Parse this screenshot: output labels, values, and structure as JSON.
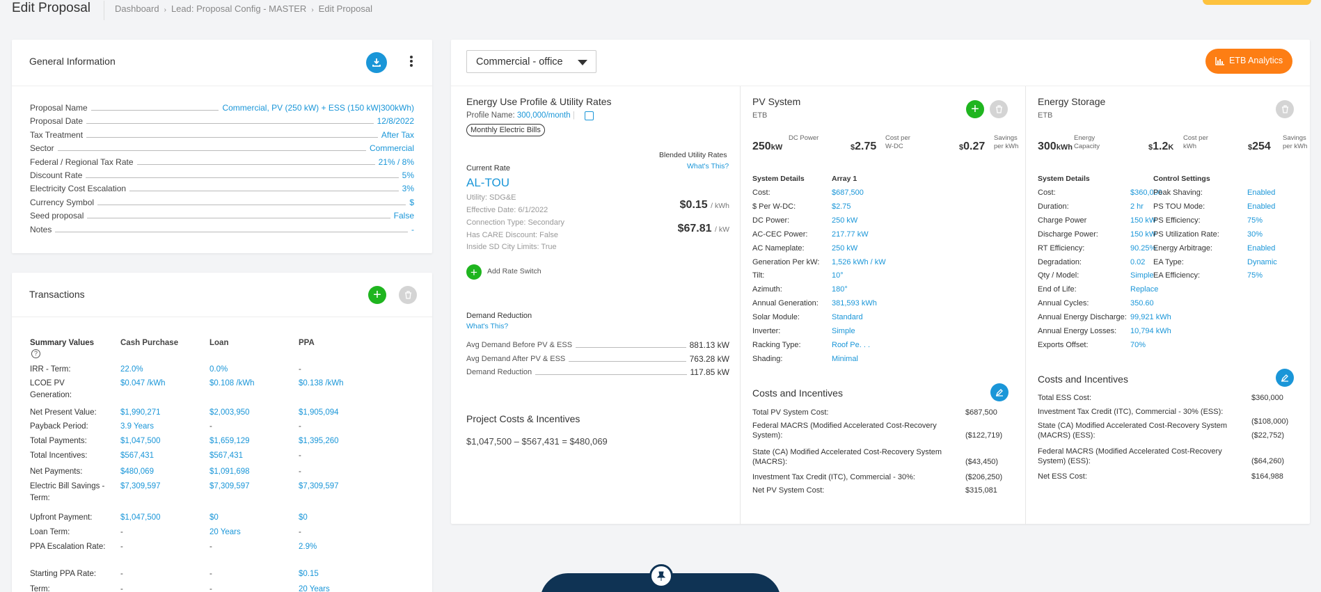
{
  "header": {
    "title": "Edit Proposal",
    "breadcrumbs": [
      "Dashboard",
      "Lead: Proposal Config - MASTER",
      "Edit Proposal"
    ]
  },
  "general": {
    "title": "General Information",
    "fields": [
      {
        "label": "Proposal Name",
        "value": "Commercial, PV (250 kW) + ESS (150 kW|300kWh)"
      },
      {
        "label": "Proposal Date",
        "value": "12/8/2022"
      },
      {
        "label": "Tax Treatment",
        "value": "After Tax"
      },
      {
        "label": "Sector",
        "value": "Commercial"
      },
      {
        "label": "Federal / Regional Tax Rate",
        "value": "21% / 8%"
      },
      {
        "label": "Discount Rate",
        "value": "5%"
      },
      {
        "label": "Electricity Cost Escalation",
        "value": "3%"
      },
      {
        "label": "Currency Symbol",
        "value": "$"
      },
      {
        "label": "Seed proposal",
        "value": "False"
      },
      {
        "label": "Notes",
        "value": "-"
      }
    ]
  },
  "transactions": {
    "title": "Transactions",
    "headers": [
      "Summary Values",
      "Cash Purchase",
      "Loan",
      "PPA"
    ],
    "help_icon": "question-circle-icon",
    "rows": [
      {
        "label": "IRR - Term:",
        "cash": "22.0%",
        "loan": "0.0%",
        "ppa": "-"
      },
      {
        "label": "LCOE PV Generation:",
        "cash": "$0.047 /kWh",
        "loan": "$0.108 /kWh",
        "ppa": "$0.138 /kWh"
      },
      {
        "label": "Net Present Value:",
        "cash": "$1,990,271",
        "loan": "$2,003,950",
        "ppa": "$1,905,094"
      },
      {
        "label": "Payback Period:",
        "cash": "3.9 Years",
        "loan": "-",
        "ppa": "-"
      },
      {
        "label": "Total Payments:",
        "cash": "$1,047,500",
        "loan": "$1,659,129",
        "ppa": "$1,395,260"
      },
      {
        "label": "Total Incentives:",
        "cash": "$567,431",
        "loan": "$567,431",
        "ppa": "-"
      },
      {
        "label": "Net Payments:",
        "cash": "$480,069",
        "loan": "$1,091,698",
        "ppa": "-"
      },
      {
        "label": "Electric Bill Savings - Term:",
        "cash": "$7,309,597",
        "loan": "$7,309,597",
        "ppa": "$7,309,597"
      },
      {
        "label": "Upfront Payment:",
        "cash": "$1,047,500",
        "loan": "$0",
        "ppa": "$0"
      },
      {
        "label": "Loan Term:",
        "cash": "-",
        "loan": "20 Years",
        "ppa": "-"
      },
      {
        "label": "PPA Escalation Rate:",
        "cash": "-",
        "loan": "-",
        "ppa": "2.9%"
      },
      {
        "label": "Starting PPA Rate:",
        "cash": "-",
        "loan": "-",
        "ppa": "$0.15"
      },
      {
        "label": "Term:",
        "cash": "-",
        "loan": "-",
        "ppa": "20 Years"
      }
    ]
  },
  "main": {
    "select_value": "Commercial - office",
    "analytics_label": "ETB Analytics"
  },
  "energy": {
    "title": "Energy Use Profile & Utility Rates",
    "profile_label": "Profile Name:",
    "profile_value": "300,000/month",
    "bills_badge": "Monthly Electric Bills",
    "blended_label": "Blended Utility Rates",
    "whats_this": "What's This?",
    "current_rate_label": "Current Rate",
    "rate_name": "AL-TOU",
    "utility": "Utility: SDG&E",
    "effective": "Effective Date: 6/1/2022",
    "connection": "Connection Type: Secondary",
    "care": "Has CARE Discount: False",
    "limits": "Inside SD City Limits: True",
    "kwh_rate": "$0.15",
    "kwh_unit": "/ kWh",
    "kw_rate": "$67.81",
    "kw_unit": "/ kW",
    "add_rate_switch": "Add Rate Switch",
    "demand_title": "Demand Reduction",
    "demand_whats": "What's This?",
    "demand_rows": [
      {
        "label": "Avg Demand Before PV & ESS",
        "value": "881.13 kW"
      },
      {
        "label": "Avg Demand After PV & ESS",
        "value": "763.28 kW"
      },
      {
        "label": "Demand Reduction",
        "value": "117.85 kW"
      }
    ],
    "project_title": "Project Costs & Incentives",
    "project_formula": "$1,047,500 – $567,431 = $480,069"
  },
  "pv": {
    "title": "PV System",
    "subtitle": "ETB",
    "stats": [
      {
        "value": "250",
        "unit": "kW",
        "label": "DC Power"
      },
      {
        "value": "2.75",
        "prefix": "$",
        "label": "Cost per W-DC"
      },
      {
        "value": "0.27",
        "prefix": "$",
        "label": "Savings per kWh"
      }
    ],
    "details_header": "System Details",
    "array_header": "Array 1",
    "details": [
      {
        "label": "Cost:",
        "value": "$687,500"
      },
      {
        "label": "$ Per W-DC:",
        "value": "$2.75"
      },
      {
        "label": "DC Power:",
        "value": "250 kW"
      },
      {
        "label": "AC-CEC Power:",
        "value": "217.77 kW"
      },
      {
        "label": "AC Nameplate:",
        "value": "250 kW"
      },
      {
        "label": "Generation Per kW:",
        "value": "1,526 kWh / kW"
      },
      {
        "label": "Tilt:",
        "value": "10°"
      },
      {
        "label": "Azimuth:",
        "value": "180°"
      },
      {
        "label": "Annual Generation:",
        "value": "381,593 kWh"
      },
      {
        "label": "Solar Module:",
        "value": "Standard"
      },
      {
        "label": "Inverter:",
        "value": "Simple"
      },
      {
        "label": "Racking Type:",
        "value": "Roof Pe. . ."
      },
      {
        "label": "Shading:",
        "value": "Minimal"
      }
    ],
    "costs_title": "Costs and Incentives",
    "costs": [
      {
        "label": "Total PV System Cost:",
        "value": "$687,500"
      },
      {
        "label": "Federal MACRS (Modified Accelerated Cost-Recovery System):",
        "value": "($122,719)"
      },
      {
        "label": "State (CA) Modified Accelerated Cost-Recovery System (MACRS):",
        "value": "($43,450)"
      },
      {
        "label": "Investment Tax Credit (ITC), Commercial - 30%:",
        "value": "($206,250)"
      },
      {
        "label": "Net PV System Cost:",
        "value": "$315,081"
      }
    ]
  },
  "ess": {
    "title": "Energy Storage",
    "subtitle": "ETB",
    "stats": [
      {
        "value": "300",
        "unit": "kWh",
        "label": "Energy Capacity"
      },
      {
        "value": "1.2",
        "prefix": "$",
        "unit": "K",
        "label": "Cost per kWh"
      },
      {
        "value": "254",
        "prefix": "$",
        "label": "Savings per kWh"
      }
    ],
    "details_header": "System Details",
    "control_header": "Control Settings",
    "details": [
      {
        "label": "Cost:",
        "value": "$360,000"
      },
      {
        "label": "Duration:",
        "value": "2 hr"
      },
      {
        "label": "Charge Power",
        "value": "150 kW"
      },
      {
        "label": "Discharge Power:",
        "value": "150 kW"
      },
      {
        "label": "RT Efficiency:",
        "value": "90.25%"
      },
      {
        "label": "Degradation:",
        "value": "0.02"
      },
      {
        "label": "Qty / Model:",
        "value": "Simple"
      },
      {
        "label": "End of Life:",
        "value": "Replace"
      },
      {
        "label": "Annual Cycles:",
        "value": "350.60"
      },
      {
        "label": "Annual Energy Discharge:",
        "value": "99,921 kWh"
      },
      {
        "label": "Annual Energy Losses:",
        "value": "10,794 kWh"
      },
      {
        "label": "Exports Offset:",
        "value": "70%"
      }
    ],
    "controls": [
      {
        "label": "Peak Shaving:",
        "value": "Enabled"
      },
      {
        "label": "PS TOU Mode:",
        "value": "Enabled"
      },
      {
        "label": "PS Efficiency:",
        "value": "75%"
      },
      {
        "label": "PS Utilization Rate:",
        "value": "30%"
      },
      {
        "label": "Energy Arbitrage:",
        "value": "Enabled"
      },
      {
        "label": "EA Type:",
        "value": "Dynamic"
      },
      {
        "label": "EA Efficiency:",
        "value": "75%"
      }
    ],
    "costs_title": "Costs and Incentives",
    "costs": [
      {
        "label": "Total ESS Cost:",
        "value": "$360,000"
      },
      {
        "label": "Investment Tax Credit (ITC), Commercial - 30% (ESS):",
        "value": "($108,000)"
      },
      {
        "label": "State (CA) Modified Accelerated Cost-Recovery System (MACRS) (ESS):",
        "value": "($22,752)"
      },
      {
        "label": "Federal MACRS (Modified Accelerated Cost-Recovery System) (ESS):",
        "value": "($64,260)"
      },
      {
        "label": "Net ESS Cost:",
        "value": "$164,988"
      }
    ]
  }
}
